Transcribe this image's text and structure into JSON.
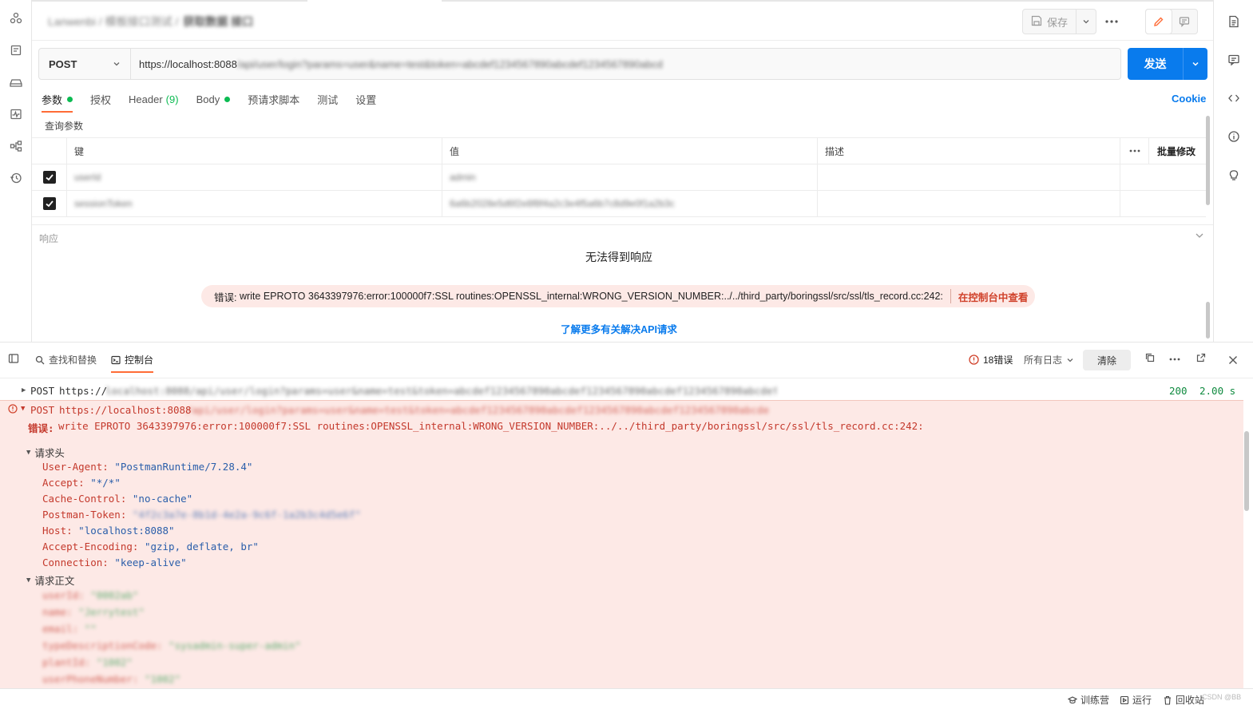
{
  "header": {
    "breadcrumb_path": "Lanwenbi / 模板接口测试 /",
    "breadcrumb_name": "获取数据 接口",
    "save_label": "保存"
  },
  "request": {
    "method": "POST",
    "url_visible": "https://localhost:8088",
    "url_rest": "/api/user/login?params=user&name=test&token=abcdef1234567890abcdef1234567890abcd",
    "send_label": "发送",
    "tabs": {
      "params": "参数",
      "auth": "授权",
      "header": "Header",
      "header_count": "(9)",
      "body": "Body",
      "prerequest": "预请求脚本",
      "tests": "测试",
      "settings": "设置"
    },
    "cookie_label": "Cookie"
  },
  "params": {
    "section_label": "查询参数",
    "columns": {
      "key": "键",
      "value": "值",
      "desc": "描述",
      "bulk": "批量修改"
    },
    "rows": [
      {
        "key": "userId",
        "value": "admin"
      },
      {
        "key": "sessionToken",
        "value": "6a6b2028e5d6f2e8f8f4a2c3e4f5a6b7c8d9e0f1a2b3c"
      }
    ]
  },
  "response": {
    "label": "响应",
    "no_response": "无法得到响应",
    "error_prefix": "错误:",
    "error_text": "write EPROTO 3643397976:error:100000f7:SSL routines:OPENSSL_internal:WRONG_VERSION_NUMBER:../../third_party/boringssl/src/ssl/tls_record.cc:242:",
    "console_link": "在控制台中查看",
    "learn_more": "了解更多有关解决API请求"
  },
  "console": {
    "find_replace": "查找和替换",
    "console_tab": "控制台",
    "error_count": "18错误",
    "log_filter": "所有日志",
    "clear_label": "清除",
    "log_ok": {
      "method": "POST",
      "url_visible": "https://",
      "url_rest": "localhost:8088/api/user/login?params=user&name=test&token=abcdef1234567890abcdef1234567890abcdef1234567890abcdef1234567890",
      "status": "200",
      "time": "2.00 s"
    },
    "log_err": {
      "method": "POST",
      "url_visible": "https://localhost:8088",
      "url_rest": "/api/user/login?params=user&name=test&token=abcdef1234567890abcdef1234567890abcdef1234567890abcdef1234",
      "error_prefix": "错误:",
      "error_text": "write EPROTO 3643397976:error:100000f7:SSL routines:OPENSSL_internal:WRONG_VERSION_NUMBER:../../third_party/boringssl/src/ssl/tls_record.cc:242:",
      "headers_label": "请求头",
      "headers": [
        {
          "k": "User-Agent:",
          "v": "\"PostmanRuntime/7.28.4\""
        },
        {
          "k": "Accept:",
          "v": "\"*/*\""
        },
        {
          "k": "Cache-Control:",
          "v": "\"no-cache\""
        },
        {
          "k": "Postman-Token:",
          "v": "\"4f2c3a7e-8b1d-4e2a-9c6f-1a2b3c4d5e6f\""
        },
        {
          "k": "Host:",
          "v": "\"localhost:8088\""
        },
        {
          "k": "Accept-Encoding:",
          "v": "\"gzip, deflate, br\""
        },
        {
          "k": "Connection:",
          "v": "\"keep-alive\""
        }
      ],
      "body_label": "请求正文",
      "body": [
        {
          "k": "userId:",
          "v": "\"0002ab\""
        },
        {
          "k": "name:",
          "v": "\"Jerrytest\""
        },
        {
          "k": "email:",
          "v": "\"\""
        },
        {
          "k": "typeDescriptionCode:",
          "v": "\"sysadmin-super-admin\""
        },
        {
          "k": "plantId:",
          "v": "\"1002\""
        },
        {
          "k": "userPhoneNumber:",
          "v": "\"1002\""
        }
      ]
    }
  },
  "statusbar": {
    "bootcamp": "训练营",
    "runner": "运行",
    "trash": "回收站",
    "watermark": "CSDN @BB"
  }
}
